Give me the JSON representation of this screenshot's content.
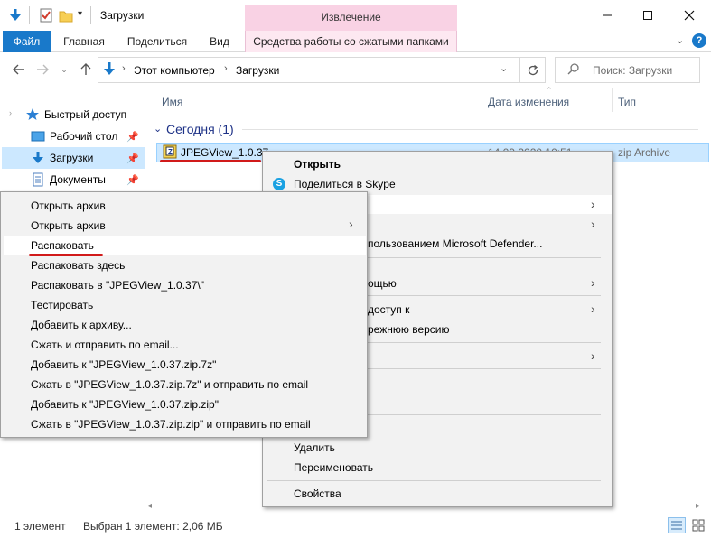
{
  "titlebar": {
    "title": "Загрузки",
    "extract_label": "Извлечение"
  },
  "ribbon": {
    "tabs": [
      {
        "label": "Файл"
      },
      {
        "label": "Главная"
      },
      {
        "label": "Поделиться"
      },
      {
        "label": "Вид"
      },
      {
        "label": "Средства работы со сжатыми папками"
      }
    ]
  },
  "address": {
    "crumbs": [
      "Этот компьютер",
      "Загрузки"
    ],
    "search_placeholder": "Поиск: Загрузки"
  },
  "sidebar": {
    "items": [
      {
        "label": "Быстрый доступ",
        "icon": "star-icon"
      },
      {
        "label": "Рабочий стол",
        "icon": "desktop-icon"
      },
      {
        "label": "Загрузки",
        "icon": "download-icon"
      },
      {
        "label": "Документы",
        "icon": "documents-icon"
      }
    ]
  },
  "filelist": {
    "columns": [
      "Имя",
      "Дата изменения",
      "Тип"
    ],
    "group": "Сегодня (1)",
    "file": {
      "name": "JPEGView_1.0.37",
      "date": "14.09.2020 10:51",
      "type": "zip Archive"
    }
  },
  "context_menu": {
    "items": [
      "Открыть",
      "Поделиться в Skype",
      "",
      "",
      "пользованием Microsoft Defender...",
      "ощью",
      "доступ к",
      "режнюю версию",
      "",
      "Удалить",
      "Переименовать",
      "Свойства"
    ]
  },
  "submenu": {
    "items": [
      "Открыть архив",
      "Открыть архив",
      "Распаковать",
      "Распаковать здесь",
      "Распаковать в \"JPEGView_1.0.37\\\"",
      "Тестировать",
      "Добавить к архиву...",
      "Сжать и отправить по email...",
      "Добавить к \"JPEGView_1.0.37.zip.7z\"",
      "Сжать в \"JPEGView_1.0.37.zip.7z\" и отправить по email",
      "Добавить к \"JPEGView_1.0.37.zip.zip\"",
      "Сжать в \"JPEGView_1.0.37.zip.zip\" и отправить по email"
    ]
  },
  "status": {
    "count": "1 элемент",
    "selected": "Выбран 1 элемент: 2,06 МБ"
  },
  "colors": {
    "accent": "#1979ca",
    "selection": "#cce8ff",
    "extract_tab": "#f9d2e4",
    "highlight_line": "#d11a1a"
  }
}
